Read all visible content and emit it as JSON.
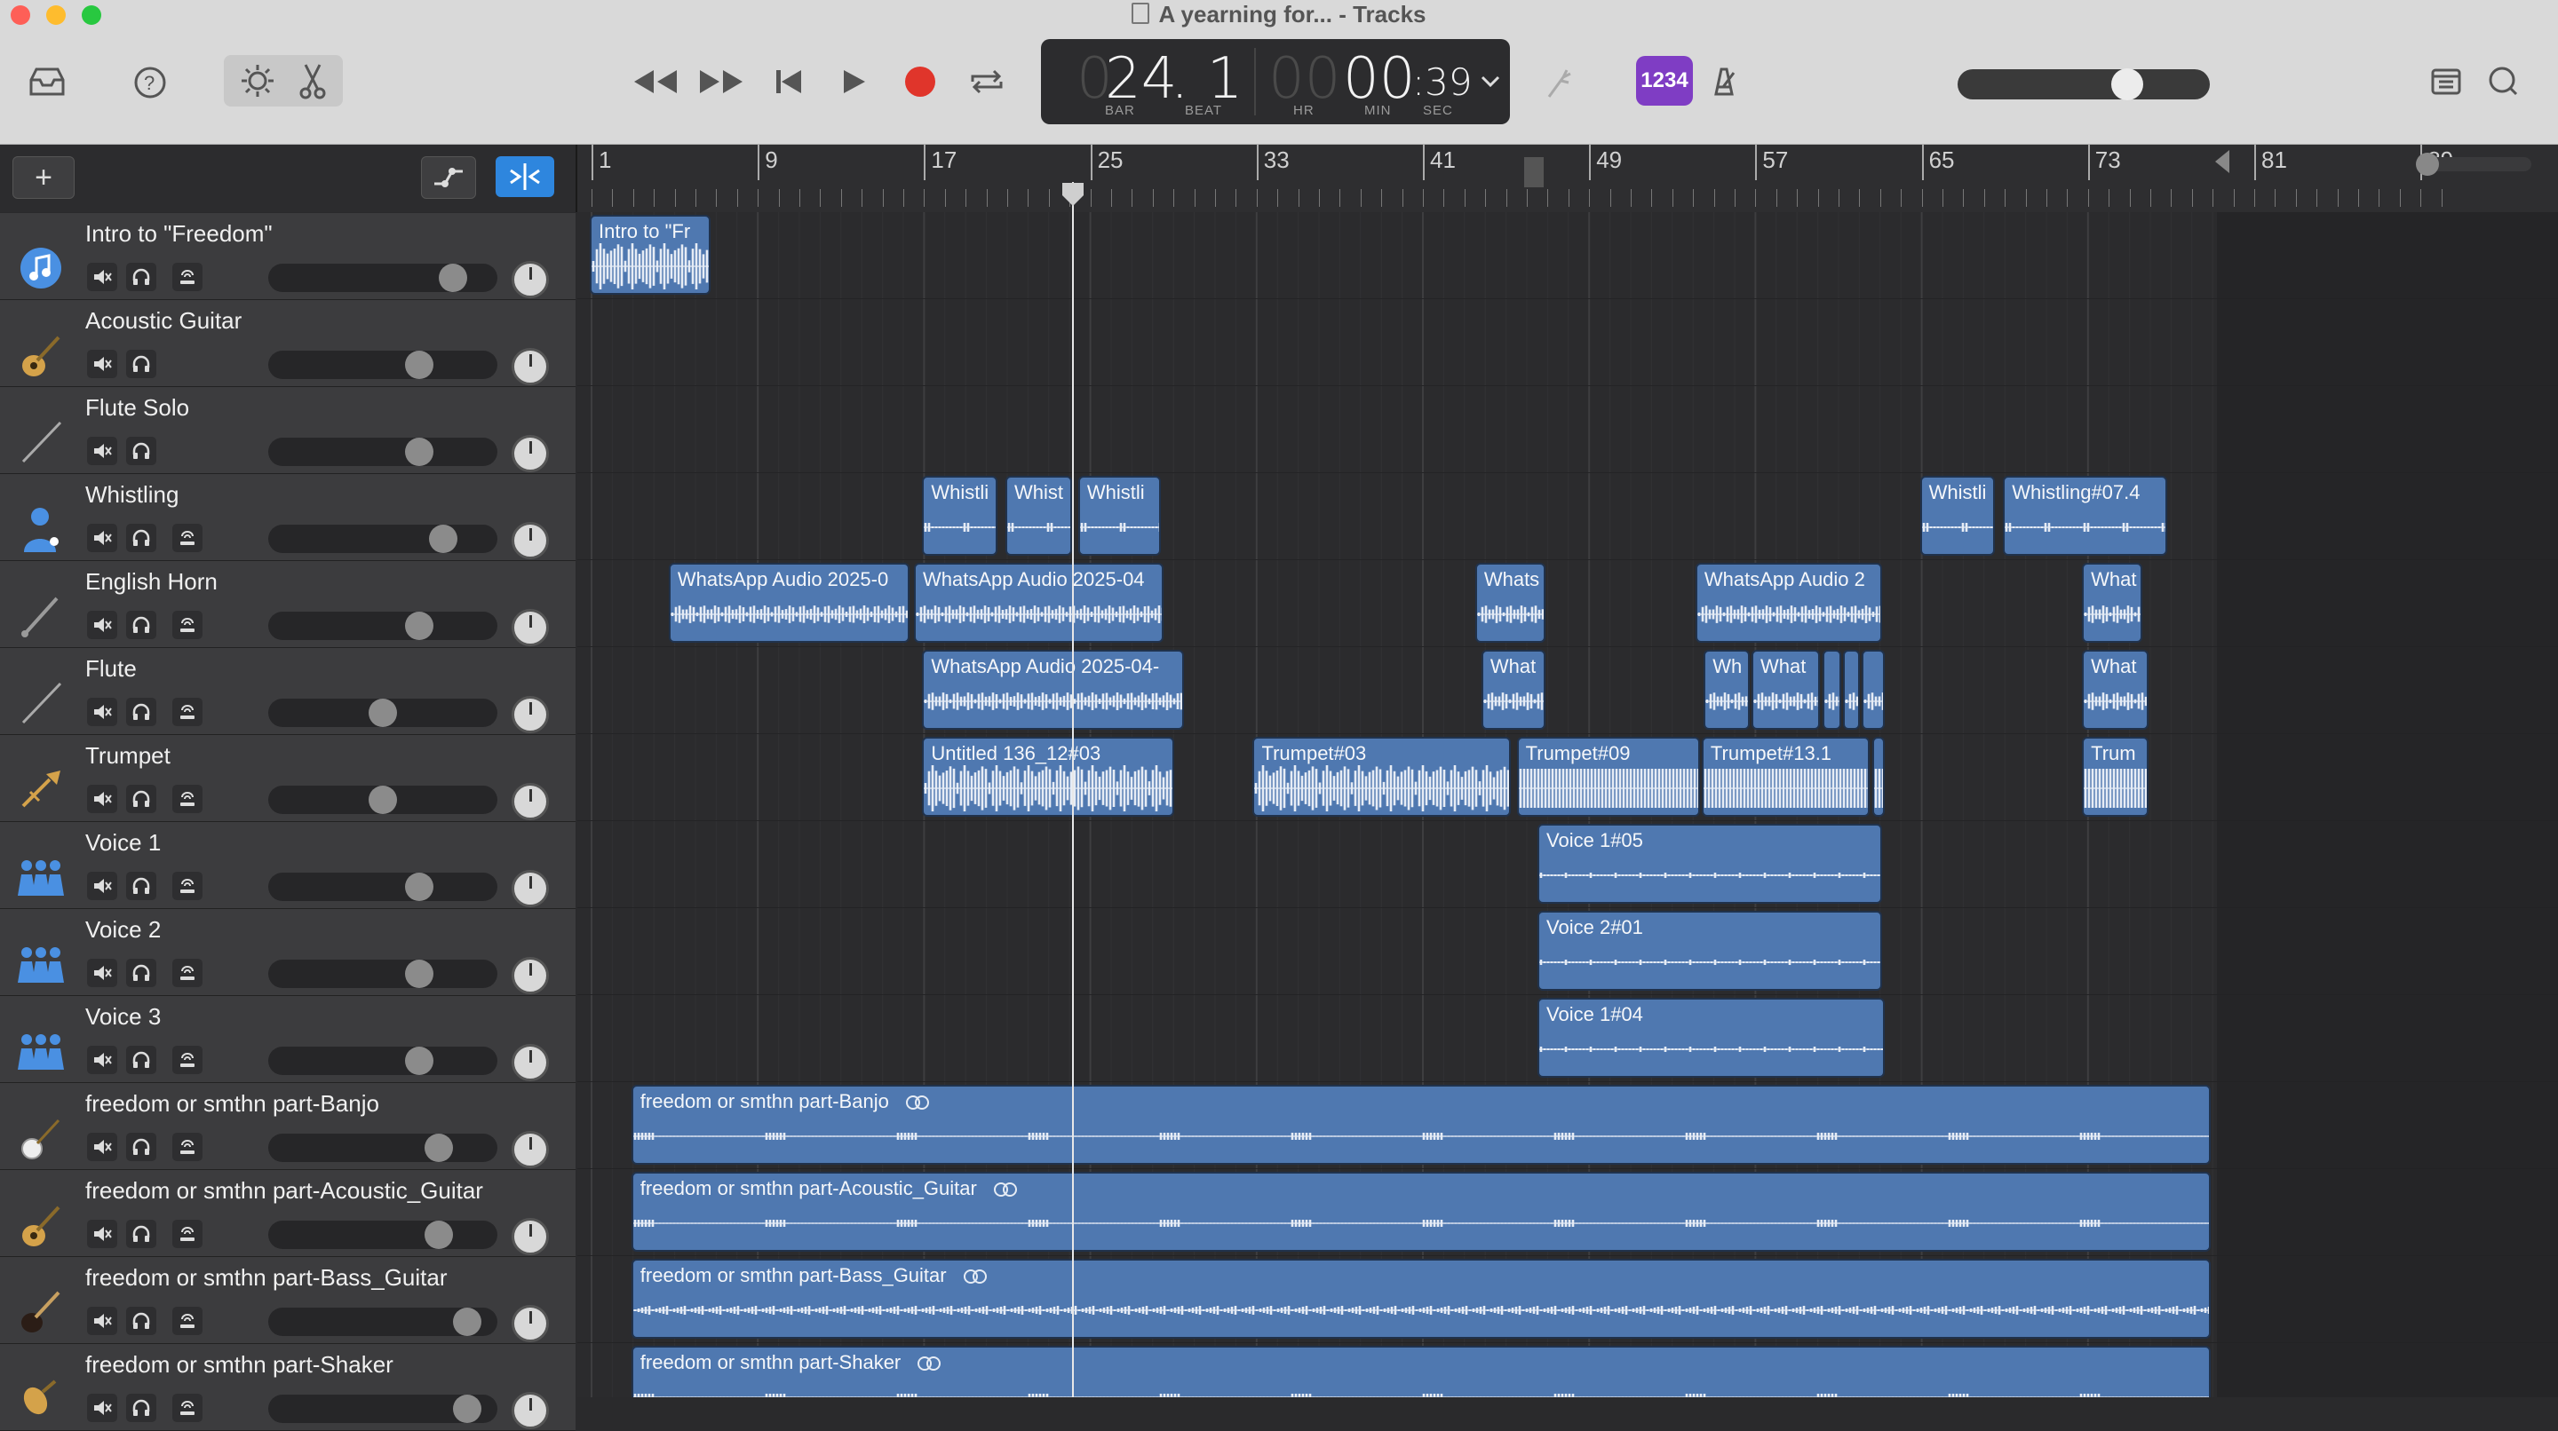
{
  "window": {
    "title": "A yearning for... - Tracks"
  },
  "toolbar": {
    "lcd": {
      "bar": "24",
      "beat": ". 1",
      "bar_cap": "BAR",
      "beat_cap": "BEAT",
      "hr": "00",
      "min": "00",
      "sec": ":39",
      "hr_cap": "HR",
      "min_cap": "MIN",
      "sec_cap": "SEC",
      "lead_digit": "0"
    },
    "count_in": "1234",
    "master_volume": 0.73
  },
  "header": {
    "add_label": "+"
  },
  "ruler": {
    "bars": [
      "1",
      "9",
      "17",
      "25",
      "33",
      "41",
      "49",
      "57",
      "65",
      "73",
      "81",
      "89"
    ]
  },
  "tracks": [
    {
      "name": "Intro to \"Freedom\"",
      "icon": "music-note-icon",
      "color": "#4a90e2",
      "volume": 0.85,
      "rec": true
    },
    {
      "name": "Acoustic Guitar",
      "icon": "acoustic-guitar-icon",
      "color": "#d4a24a",
      "volume": 0.68,
      "rec": false
    },
    {
      "name": "Flute Solo",
      "icon": "flute-icon",
      "color": "#aaa",
      "volume": 0.68,
      "rec": false
    },
    {
      "name": "Whistling",
      "icon": "singer-icon",
      "color": "#4a90e2",
      "volume": 0.8,
      "rec": true
    },
    {
      "name": "English Horn",
      "icon": "english-horn-icon",
      "color": "#aaa",
      "volume": 0.68,
      "rec": true
    },
    {
      "name": "Flute",
      "icon": "flute-icon",
      "color": "#aaa",
      "volume": 0.5,
      "rec": true
    },
    {
      "name": "Trumpet",
      "icon": "trumpet-icon",
      "color": "#d4a24a",
      "volume": 0.5,
      "rec": true
    },
    {
      "name": "Voice 1",
      "icon": "choir-icon",
      "color": "#4a90e2",
      "volume": 0.68,
      "rec": true
    },
    {
      "name": "Voice 2",
      "icon": "choir-icon",
      "color": "#4a90e2",
      "volume": 0.68,
      "rec": true
    },
    {
      "name": "Voice 3",
      "icon": "choir-icon",
      "color": "#4a90e2",
      "volume": 0.68,
      "rec": true
    },
    {
      "name": "freedom or smthn part-Banjo",
      "icon": "banjo-icon",
      "color": "#ddd",
      "volume": 0.78,
      "rec": true
    },
    {
      "name": "freedom or smthn part-Acoustic_Guitar",
      "icon": "acoustic-guitar-icon",
      "color": "#d4a24a",
      "volume": 0.78,
      "rec": true
    },
    {
      "name": "freedom or smthn part-Bass_Guitar",
      "icon": "bass-guitar-icon",
      "color": "#c0392b",
      "volume": 0.92,
      "rec": true
    },
    {
      "name": "freedom or smthn part-Shaker",
      "icon": "shaker-icon",
      "color": "#d4a24a",
      "volume": 0.92,
      "rec": true
    }
  ],
  "regions": [
    {
      "track": 0,
      "start": 1,
      "end": 6.8,
      "label": "Intro to \"Fr",
      "shape": "dense"
    },
    {
      "track": 3,
      "start": 17,
      "end": 20.6,
      "label": "Whistli",
      "shape": "sparse"
    },
    {
      "track": 3,
      "start": 21,
      "end": 24.2,
      "label": "Whist",
      "shape": "sparse"
    },
    {
      "track": 3,
      "start": 24.5,
      "end": 28.5,
      "label": "Whistli",
      "shape": "sparse"
    },
    {
      "track": 3,
      "start": 65,
      "end": 68.6,
      "label": "Whistli",
      "shape": "sparse"
    },
    {
      "track": 3,
      "start": 69,
      "end": 76.9,
      "label": "Whistling#07.4",
      "shape": "sparse"
    },
    {
      "track": 4,
      "start": 4.8,
      "end": 16.4,
      "label": "WhatsApp Audio 2025-0",
      "shape": "mid"
    },
    {
      "track": 4,
      "start": 16.6,
      "end": 28.6,
      "label": "WhatsApp Audio 2025-04",
      "shape": "mid"
    },
    {
      "track": 4,
      "start": 43.6,
      "end": 47,
      "label": "Whats",
      "shape": "mid"
    },
    {
      "track": 4,
      "start": 54.2,
      "end": 63.2,
      "label": "WhatsApp Audio 2",
      "shape": "mid"
    },
    {
      "track": 4,
      "start": 72.8,
      "end": 75.7,
      "label": "What",
      "shape": "mid"
    },
    {
      "track": 5,
      "start": 17,
      "end": 29.6,
      "label": "WhatsApp Audio 2025-04-",
      "shape": "mid"
    },
    {
      "track": 5,
      "start": 43.9,
      "end": 47,
      "label": "What",
      "shape": "mid"
    },
    {
      "track": 5,
      "start": 54.6,
      "end": 56.8,
      "label": "Wh",
      "shape": "mid"
    },
    {
      "track": 5,
      "start": 56.9,
      "end": 60.2,
      "label": "What",
      "shape": "mid"
    },
    {
      "track": 5,
      "start": 60.3,
      "end": 61.2,
      "label": "",
      "shape": "mid"
    },
    {
      "track": 5,
      "start": 61.3,
      "end": 62.1,
      "label": "",
      "shape": "mid"
    },
    {
      "track": 5,
      "start": 62.2,
      "end": 63.3,
      "label": "",
      "shape": "mid"
    },
    {
      "track": 5,
      "start": 72.8,
      "end": 76,
      "label": "What",
      "shape": "mid"
    },
    {
      "track": 6,
      "start": 17,
      "end": 29.1,
      "label": "Untitled 136_12#03",
      "shape": "dense"
    },
    {
      "track": 6,
      "start": 32.9,
      "end": 45.3,
      "label": "Trumpet#03",
      "shape": "dense"
    },
    {
      "track": 6,
      "start": 45.6,
      "end": 54.4,
      "label": "Trumpet#09",
      "shape": "block"
    },
    {
      "track": 6,
      "start": 54.5,
      "end": 62.6,
      "label": "Trumpet#13.1",
      "shape": "block"
    },
    {
      "track": 6,
      "start": 62.7,
      "end": 63.3,
      "label": "",
      "shape": "block"
    },
    {
      "track": 6,
      "start": 72.8,
      "end": 76,
      "label": "Trum",
      "shape": "block"
    },
    {
      "track": 7,
      "start": 46.6,
      "end": 63.2,
      "label": "Voice 1#05",
      "shape": "thin"
    },
    {
      "track": 8,
      "start": 46.6,
      "end": 63.2,
      "label": "Voice 2#01",
      "shape": "thin"
    },
    {
      "track": 9,
      "start": 46.6,
      "end": 63.3,
      "label": "Voice 1#04",
      "shape": "thin"
    },
    {
      "track": 10,
      "start": 3,
      "end": 79,
      "label": "freedom or smthn part-Banjo",
      "shape": "line",
      "loop": true
    },
    {
      "track": 11,
      "start": 3,
      "end": 79,
      "label": "freedom or smthn part-Acoustic_Guitar",
      "shape": "line",
      "loop": true
    },
    {
      "track": 12,
      "start": 3,
      "end": 79,
      "label": "freedom or smthn part-Bass_Guitar",
      "shape": "fuzz",
      "loop": true
    },
    {
      "track": 13,
      "start": 3,
      "end": 79,
      "label": "freedom or smthn part-Shaker",
      "shape": "line",
      "loop": true
    }
  ],
  "playhead_bar": 24.1,
  "colors": {
    "region": "#4f78b0",
    "record": "#e0352b",
    "accent": "#2e86de"
  }
}
